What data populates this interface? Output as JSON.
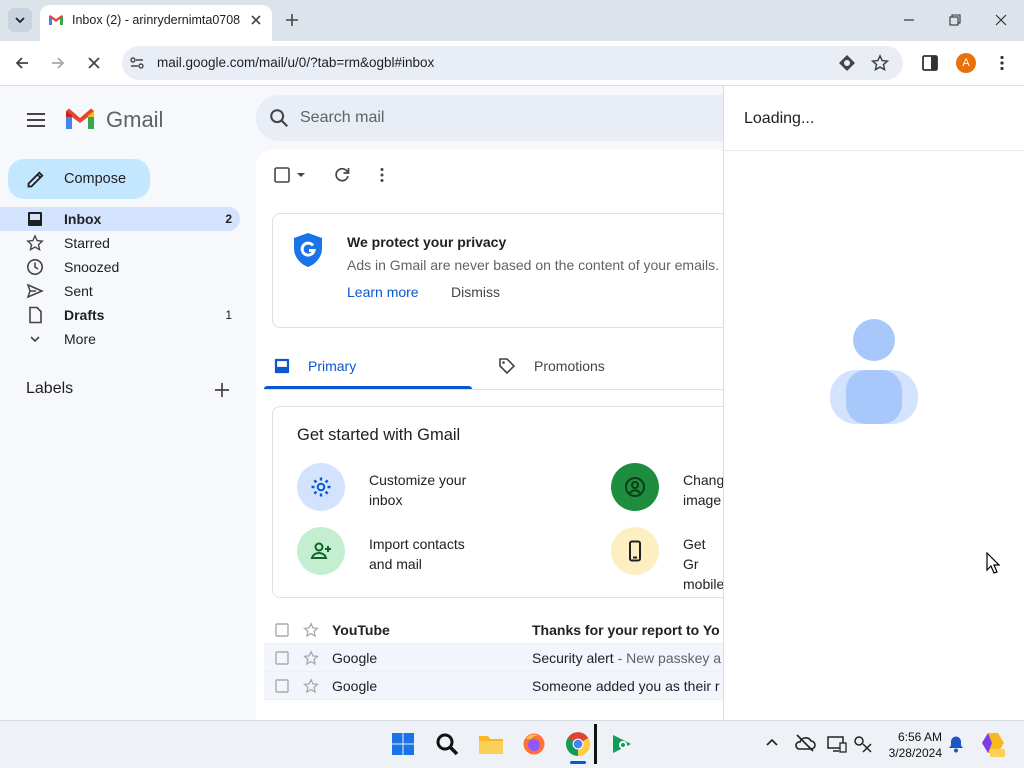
{
  "browser": {
    "tab_title": "Inbox (2) - arinrydernimta0708",
    "url": "mail.google.com/mail/u/0/?tab=rm&ogbl#inbox",
    "profile_initial": "A"
  },
  "gmail": {
    "logo_text": "Gmail",
    "compose_label": "Compose",
    "search_placeholder": "Search mail",
    "nav": [
      {
        "label": "Inbox",
        "count": "2"
      },
      {
        "label": "Starred",
        "count": ""
      },
      {
        "label": "Snoozed",
        "count": ""
      },
      {
        "label": "Sent",
        "count": ""
      },
      {
        "label": "Drafts",
        "count": "1"
      },
      {
        "label": "More",
        "count": ""
      }
    ],
    "labels_heading": "Labels",
    "privacy": {
      "title": "We protect your privacy",
      "body": "Ads in Gmail are never based on the content of your emails.",
      "learn_more": "Learn more",
      "dismiss": "Dismiss"
    },
    "tabs": [
      {
        "label": "Primary"
      },
      {
        "label": "Promotions"
      }
    ],
    "get_started": {
      "title": "Get started with Gmail",
      "items": [
        {
          "label_line1": "Customize your",
          "label_line2": "inbox"
        },
        {
          "label_line1": "Chang",
          "label_line2": "image"
        },
        {
          "label_line1": "Import contacts",
          "label_line2": "and mail"
        },
        {
          "label_line1": "Get Gr",
          "label_line2": "mobile"
        }
      ]
    },
    "emails": [
      {
        "sender": "YouTube",
        "subject": "Thanks for your report to Yo",
        "snippet": "",
        "unread": true
      },
      {
        "sender": "Google",
        "subject": "Security alert",
        "snippet": " - New passkey a",
        "unread": false
      },
      {
        "sender": "Google",
        "subject": "Someone added you as their r",
        "snippet": "",
        "unread": false
      }
    ],
    "side_panel": {
      "loading_text": "Loading..."
    }
  },
  "taskbar": {
    "time": "6:56 AM",
    "date": "3/28/2024"
  },
  "colors": {
    "accent": "#0b57d0",
    "compose_bg": "#c2e7ff",
    "selected_nav": "#d3e3fd"
  }
}
